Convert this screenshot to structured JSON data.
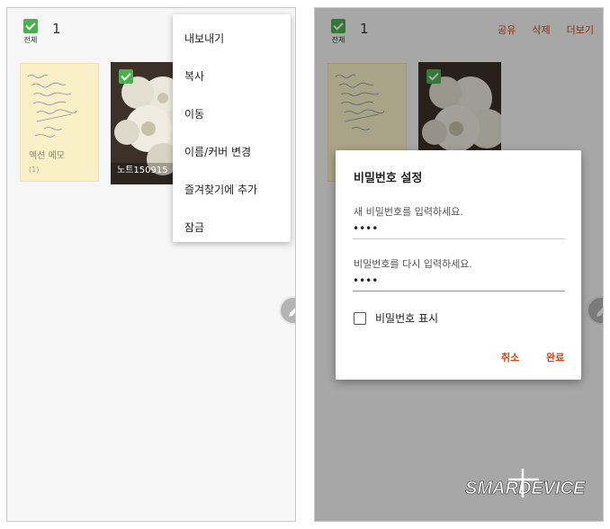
{
  "left": {
    "select_all_label": "전체",
    "selected_count": "1",
    "notes": [
      {
        "title": "액션 메모",
        "count": "(1)"
      },
      {
        "title": "노트150915"
      }
    ],
    "menu_items": [
      "내보내기",
      "복사",
      "이동",
      "이름/커버 변경",
      "즐겨찾기에 추가",
      "잠금"
    ]
  },
  "right": {
    "select_all_label": "전체",
    "selected_count": "1",
    "actions": [
      "공유",
      "삭제",
      "더보기"
    ],
    "dialog": {
      "title": "비밀번호 설정",
      "new_password_label": "새 비밀번호를 입력하세요.",
      "new_password_value": "••••",
      "confirm_password_label": "비밀번호를 다시 입력하세요.",
      "confirm_password_value": "••••",
      "show_password_label": "비밀번호 표시",
      "show_password_checked": false,
      "cancel_label": "취소",
      "done_label": "완료"
    }
  },
  "colors": {
    "accent": "#d84315",
    "checkbox": "#4caf50",
    "memo_bg": "#faf0c8"
  },
  "icons": [
    "checkbox-checked-icon",
    "pen-icon",
    "checkbox-unchecked-icon"
  ]
}
